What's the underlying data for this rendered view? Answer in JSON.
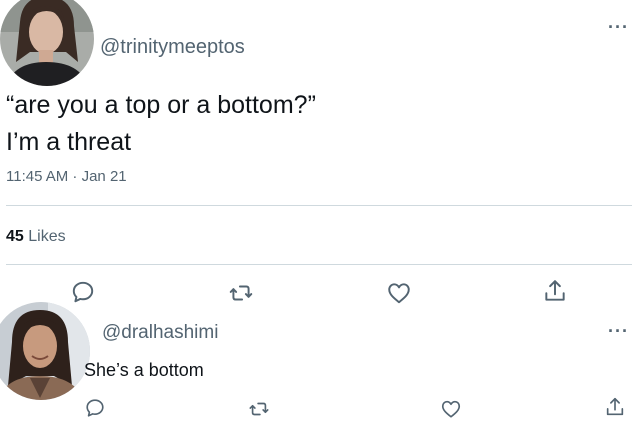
{
  "tweet": {
    "handle": "@trinitymeeptos",
    "text_line1": "“are you a top or a bottom?”",
    "text_line2": "I’m a threat",
    "timestamp": "11:45 AM · Jan 21",
    "likes_count": "45",
    "likes_label": "Likes",
    "more_label": "···"
  },
  "reply": {
    "handle": "@dralhashimi",
    "text": "She’s a bottom",
    "more_label": "···"
  },
  "icons": {
    "reply": "reply-icon",
    "retweet": "retweet-icon",
    "like": "like-icon",
    "share": "share-icon",
    "more": "more-icon"
  },
  "colors": {
    "text": "#0f1419",
    "secondary": "#536471",
    "divider": "#cfd9de"
  }
}
